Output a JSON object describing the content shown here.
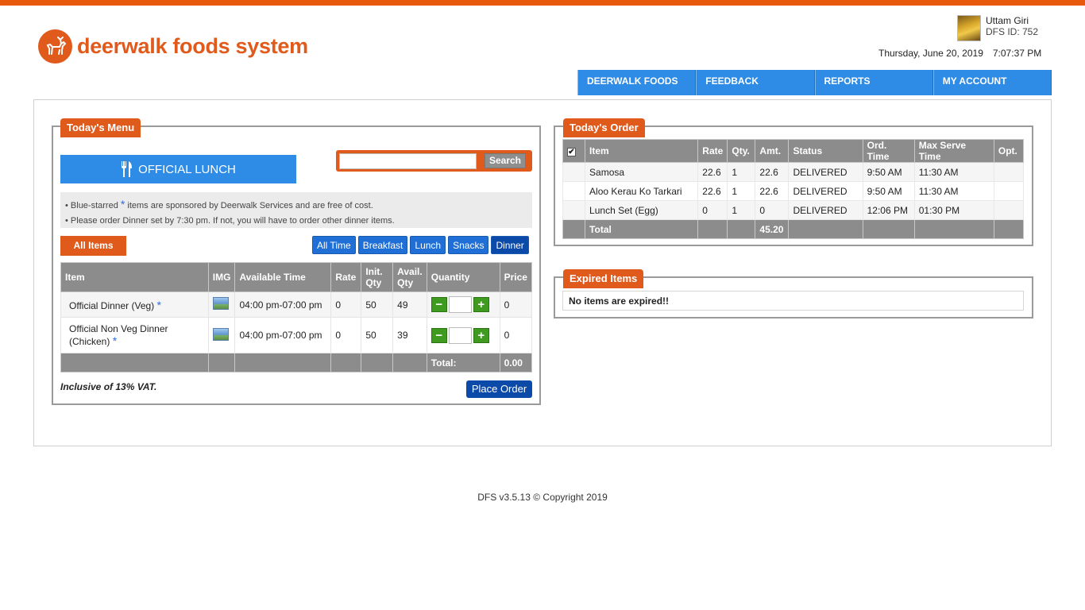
{
  "brand": {
    "name": "deerwalk foods system",
    "accent": "#e05a1c",
    "nav_color": "#2e8be6"
  },
  "user": {
    "name": "Uttam Giri",
    "dfs_id": "DFS ID: 752"
  },
  "datetime": {
    "date": "Thursday, June 20, 2019",
    "time": "7:07:37 PM"
  },
  "nav": [
    "DEERWALK FOODS",
    "FEEDBACK",
    "REPORTS",
    "MY ACCOUNT"
  ],
  "menu": {
    "tab": "Today's Menu",
    "lunch_button": "OFFICIAL LUNCH",
    "search_button": "Search",
    "search_value": "",
    "notes": {
      "line1_pre": "• Blue-starred",
      "line1_post": "items are sponsored by Deerwalk Services and are free of cost.",
      "line2": "• Please order Dinner set by 7:30 pm. If not, you will have to order other dinner items."
    },
    "all_items": "All Items",
    "filters": [
      "All Time",
      "Breakfast",
      "Lunch",
      "Snacks",
      "Dinner"
    ],
    "columns": {
      "item": "Item",
      "img": "IMG",
      "time": "Available Time",
      "rate": "Rate",
      "init_qty": "Init. Qty",
      "avail_qty": "Avail. Qty",
      "quantity": "Quantity",
      "price": "Price"
    },
    "rows": [
      {
        "item": "Official Dinner (Veg)",
        "time": "04:00 pm-07:00 pm",
        "rate": "0",
        "init": "50",
        "avail": "49",
        "price": "0"
      },
      {
        "item": "Official Non Veg Dinner (Chicken)",
        "time": "04:00 pm-07:00 pm",
        "rate": "0",
        "init": "50",
        "avail": "39",
        "price": "0"
      }
    ],
    "total_label": "Total:",
    "total_value": "0.00",
    "vat": "Inclusive of 13% VAT.",
    "place_order": "Place Order"
  },
  "order": {
    "tab": "Today's Order",
    "columns": {
      "item": "Item",
      "rate": "Rate",
      "qty": "Qty.",
      "amt": "Amt.",
      "status": "Status",
      "ord_time": "Ord. Time",
      "max_serve": "Max Serve Time",
      "opt": "Opt."
    },
    "rows": [
      {
        "item": "Samosa",
        "rate": "22.6",
        "qty": "1",
        "amt": "22.6",
        "status": "DELIVERED",
        "ord_time": "9:50 AM",
        "max_serve": "11:30 AM"
      },
      {
        "item": "Aloo Kerau Ko Tarkari",
        "rate": "22.6",
        "qty": "1",
        "amt": "22.6",
        "status": "DELIVERED",
        "ord_time": "9:50 AM",
        "max_serve": "11:30 AM"
      },
      {
        "item": "Lunch Set (Egg)",
        "rate": "0",
        "qty": "1",
        "amt": "0",
        "status": "DELIVERED",
        "ord_time": "12:06 PM",
        "max_serve": "01:30 PM"
      }
    ],
    "total_label": "Total",
    "total_value": "45.20"
  },
  "expired": {
    "tab": "Expired Items",
    "message": "No items are expired!!"
  },
  "footer": "DFS v3.5.13 © Copyright 2019"
}
